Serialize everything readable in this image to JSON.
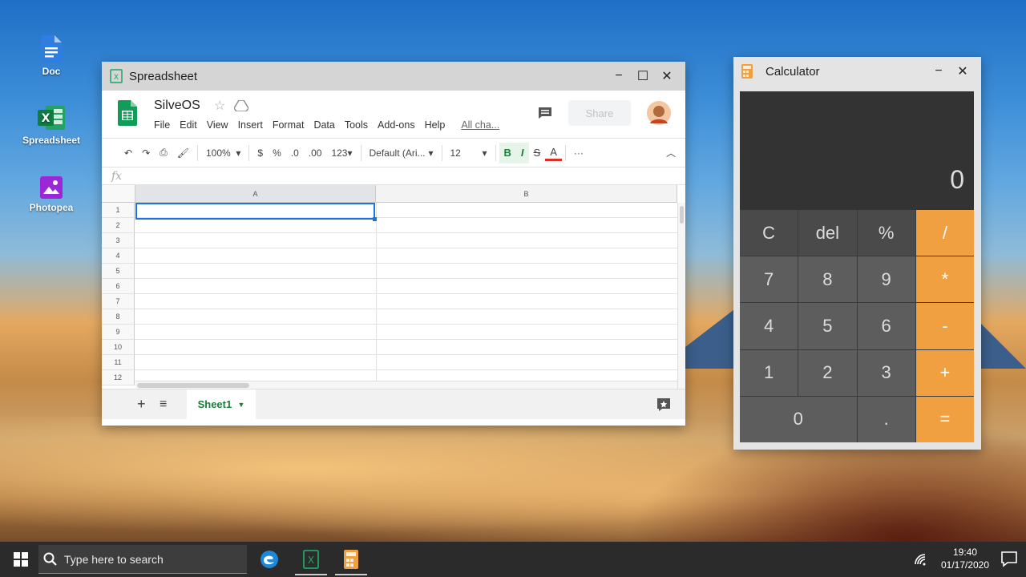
{
  "desktop": {
    "icons": [
      {
        "label": "Doc"
      },
      {
        "label": "Spreadsheet"
      },
      {
        "label": "Photopea"
      }
    ]
  },
  "spreadsheet_window": {
    "title": "Spreadsheet",
    "doc_title": "SilveOS",
    "menu": [
      "File",
      "Edit",
      "View",
      "Insert",
      "Format",
      "Data",
      "Tools",
      "Add-ons",
      "Help"
    ],
    "all_changes": "All cha...",
    "share_label": "Share",
    "toolbar": {
      "zoom": "100%",
      "currency": "$",
      "percent": "%",
      "dec_decrease": ".0",
      "dec_increase": ".00",
      "number_format": "123",
      "font": "Default (Ari...",
      "font_size": "12",
      "bold": "B",
      "italic": "I",
      "strike": "S",
      "text_color": "A",
      "more": "···"
    },
    "fx_symbol": "fx",
    "columns": [
      "A",
      "B"
    ],
    "rows": [
      "1",
      "2",
      "3",
      "4",
      "5",
      "6",
      "7",
      "8",
      "9",
      "10",
      "11",
      "12"
    ],
    "sheet_tab": "Sheet1"
  },
  "calculator_window": {
    "title": "Calculator",
    "display": "0",
    "keys": [
      "C",
      "del",
      "%",
      "/",
      "7",
      "8",
      "9",
      "*",
      "4",
      "5",
      "6",
      "-",
      "1",
      "2",
      "3",
      "+",
      "0",
      ".",
      "="
    ]
  },
  "taskbar": {
    "search_placeholder": "Type here to search",
    "time": "19:40",
    "date": "01/17/2020"
  },
  "colors": {
    "sheets_green": "#188038",
    "calc_orange": "#f0a040",
    "selection_blue": "#1a73e8",
    "taskbar": "#2b2b2b"
  }
}
